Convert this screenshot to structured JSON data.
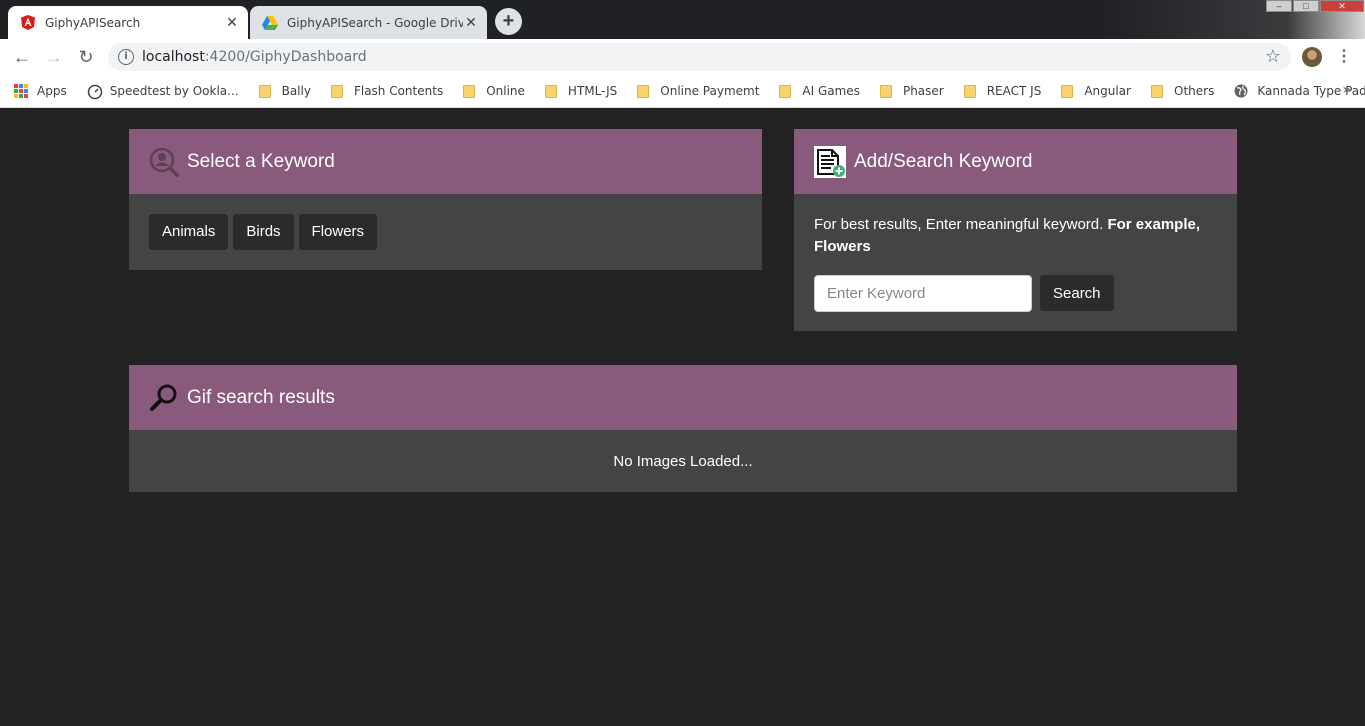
{
  "browser": {
    "tabs": [
      {
        "title": "GiphyAPISearch",
        "active": true,
        "icon": "angular-icon"
      },
      {
        "title": "GiphyAPISearch - Google Drive",
        "active": false,
        "icon": "google-drive-icon"
      }
    ],
    "address": {
      "host": "localhost",
      "path": ":4200/GiphyDashboard"
    },
    "bookmarks": [
      {
        "label": "Apps",
        "icon": "apps-grid-icon"
      },
      {
        "label": "Speedtest by Ookla...",
        "icon": "speedometer-icon"
      },
      {
        "label": "Bally",
        "icon": "folder-icon"
      },
      {
        "label": "Flash Contents",
        "icon": "folder-icon"
      },
      {
        "label": "Online",
        "icon": "folder-icon"
      },
      {
        "label": "HTML-JS",
        "icon": "folder-icon"
      },
      {
        "label": "Online Paymemt",
        "icon": "folder-icon"
      },
      {
        "label": "AI Games",
        "icon": "folder-icon"
      },
      {
        "label": "Phaser",
        "icon": "folder-icon"
      },
      {
        "label": "REACT JS",
        "icon": "folder-icon"
      },
      {
        "label": "Angular",
        "icon": "folder-icon"
      },
      {
        "label": "Others",
        "icon": "folder-icon"
      },
      {
        "label": "Kannada Type Pad...",
        "icon": "globe-icon"
      }
    ]
  },
  "select_panel": {
    "title": "Select a Keyword",
    "keywords": [
      "Animals",
      "Birds",
      "Flowers"
    ]
  },
  "add_panel": {
    "title": "Add/Search Keyword",
    "hint": "For best results, Enter meaningful keyword.",
    "hint_bold": "For example, Flowers",
    "input_placeholder": "Enter Keyword",
    "input_value": "",
    "search_label": "Search"
  },
  "results_panel": {
    "title": "Gif search results",
    "empty_message": "No Images Loaded..."
  },
  "colors": {
    "page_bg": "#222222",
    "panel_header": "#8a5a7c",
    "panel_body": "#444444",
    "button_bg": "#2b2b2b"
  }
}
